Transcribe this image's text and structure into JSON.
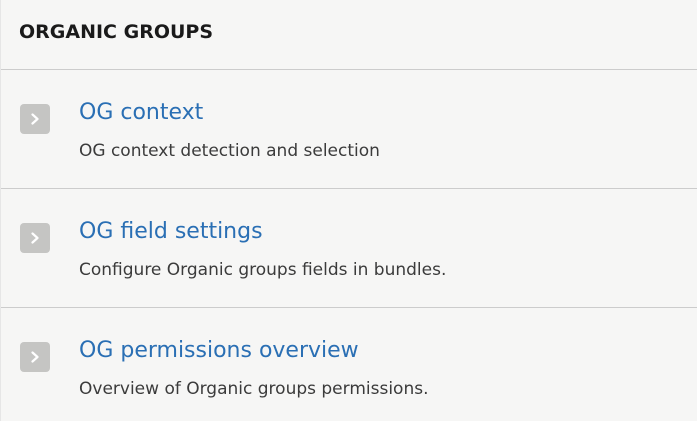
{
  "panel": {
    "title": "ORGANIC GROUPS"
  },
  "items": [
    {
      "icon": "chevron-right-icon",
      "label": "OG context",
      "description": "OG context detection and selection"
    },
    {
      "icon": "chevron-right-icon",
      "label": "OG field settings",
      "description": "Configure Organic groups fields in bundles."
    },
    {
      "icon": "chevron-right-icon",
      "label": "OG permissions overview",
      "description": "Overview of Organic groups permissions."
    }
  ],
  "colors": {
    "link": "#2a6fb4",
    "description": "#3b3b3b",
    "title": "#1a1a1a",
    "background": "#f6f6f5",
    "icon_background": "#c5c5c3",
    "divider": "#cccccc"
  }
}
